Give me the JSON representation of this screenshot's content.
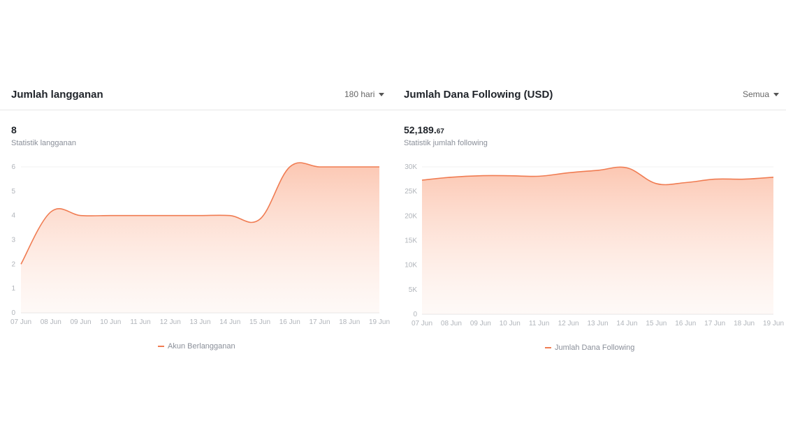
{
  "panels": [
    {
      "title": "Jumlah langganan",
      "dropdown": "180 hari",
      "value_main": "8",
      "value_dec": "",
      "stat_label": "Statistik langganan",
      "legend": "Akun Berlangganan"
    },
    {
      "title": "Jumlah Dana Following (USD)",
      "dropdown": "Semua",
      "value_main": "52,189.",
      "value_dec": "67",
      "stat_label": "Statistik jumlah following",
      "legend": "Jumlah Dana Following"
    }
  ],
  "colors": {
    "line": "#f07c52",
    "fill": "#fcc9b6",
    "grid": "#f0f0f0"
  },
  "chart_data": [
    {
      "type": "area",
      "x": [
        "07 Jun",
        "08 Jun",
        "09 Jun",
        "10 Jun",
        "11 Jun",
        "12 Jun",
        "13 Jun",
        "14 Jun",
        "15 Jun",
        "16 Jun",
        "17 Jun",
        "18 Jun",
        "19 Jun"
      ],
      "series": [
        {
          "name": "Akun Berlangganan",
          "values": [
            2,
            4.15,
            4,
            4,
            4,
            4,
            4,
            4,
            3.85,
            6,
            6,
            6,
            6
          ]
        }
      ],
      "yticks": [
        "0",
        "1",
        "2",
        "3",
        "4",
        "5",
        "6"
      ],
      "ylim": [
        0,
        6
      ],
      "grid": false,
      "legend": "bottom"
    },
    {
      "type": "area",
      "x": [
        "07 Jun",
        "08 Jun",
        "09 Jun",
        "10 Jun",
        "11 Jun",
        "12 Jun",
        "13 Jun",
        "14 Jun",
        "15 Jun",
        "16 Jun",
        "17 Jun",
        "18 Jun",
        "19 Jun"
      ],
      "series": [
        {
          "name": "Jumlah Dana Following",
          "values": [
            27300,
            27900,
            28200,
            28200,
            28100,
            28800,
            29300,
            29800,
            26600,
            26800,
            27500,
            27500,
            27900
          ]
        }
      ],
      "yticks": [
        "0",
        "5K",
        "10K",
        "15K",
        "20K",
        "25K",
        "30K"
      ],
      "ylim": [
        0,
        30000
      ],
      "grid": false,
      "legend": "bottom"
    }
  ]
}
